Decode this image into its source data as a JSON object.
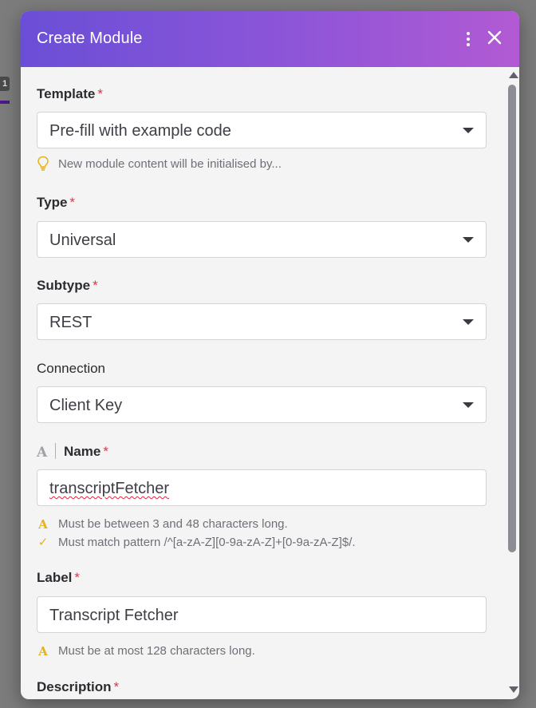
{
  "background": {
    "badge": "1"
  },
  "modal": {
    "title": "Create Module",
    "template": {
      "label": "Template",
      "required_mark": "*",
      "value": "Pre-fill with example code",
      "hint": "New module content will be initialised by..."
    },
    "type": {
      "label": "Type",
      "required_mark": "*",
      "value": "Universal"
    },
    "subtype": {
      "label": "Subtype",
      "required_mark": "*",
      "value": "REST"
    },
    "connection": {
      "label": "Connection",
      "value": "Client Key"
    },
    "name": {
      "label": "Name",
      "required_mark": "*",
      "value": "transcriptFetcher",
      "hints": [
        "Must be between 3 and 48 characters long.",
        "Must match pattern /^[a-zA-Z][0-9a-zA-Z]+[0-9a-zA-Z]$/."
      ]
    },
    "label_field": {
      "label": "Label",
      "required_mark": "*",
      "value": "Transcript Fetcher",
      "hint": "Must be at most 128 characters long."
    },
    "description": {
      "label": "Description",
      "required_mark": "*"
    }
  },
  "icons": {
    "menu": "kebab-menu-icon",
    "close": "close-icon",
    "template_hint": "lightbulb-icon",
    "name_type": "text-type-icon",
    "warning": "warning-icon",
    "check": "check-icon"
  },
  "colors": {
    "header_start": "#6a4fd6",
    "header_end": "#b25ad3",
    "required": "#d9364d",
    "hint_icon": "#e6b21a"
  }
}
